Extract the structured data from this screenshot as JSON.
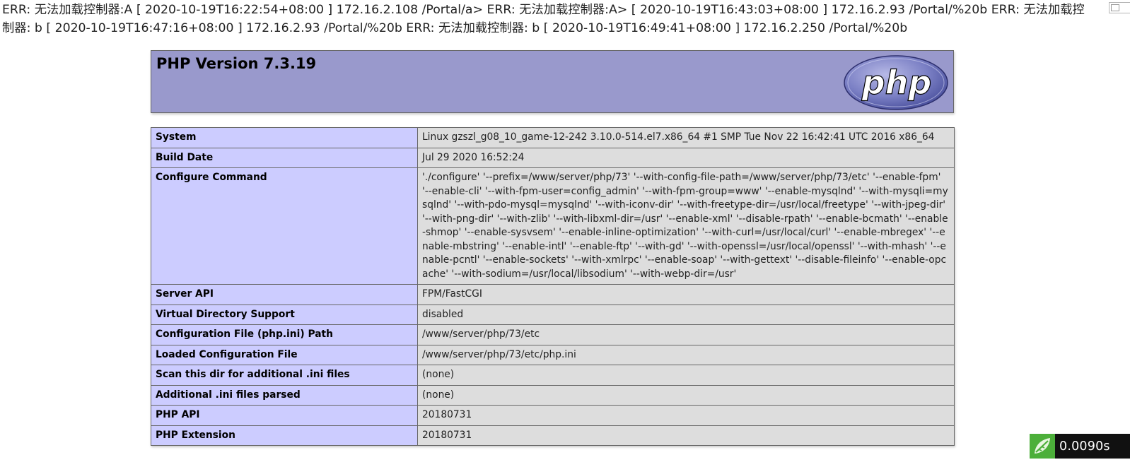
{
  "error_messages": "ERR: 无法加载控制器:A [ 2020-10-19T16:22:54+08:00 ] 172.16.2.108 /Portal/a> ERR: 无法加载控制器:A> [ 2020-10-19T16:43:03+08:00 ] 172.16.2.93 /Portal/%20b ERR: 无法加载控制器: b [ 2020-10-19T16:47:16+08:00 ] 172.16.2.93 /Portal/%20b ERR: 无法加载控制器: b [ 2020-10-19T16:49:41+08:00 ] 172.16.2.250 /Portal/%20b",
  "header": {
    "title": "PHP Version 7.3.19",
    "logo_text": "php"
  },
  "info_rows": [
    {
      "label": "System",
      "value": "Linux gzszl_g08_10_game-12-242 3.10.0-514.el7.x86_64 #1 SMP Tue Nov 22 16:42:41 UTC 2016 x86_64"
    },
    {
      "label": "Build Date",
      "value": "Jul 29 2020 16:52:24"
    },
    {
      "label": "Configure Command",
      "value": "'./configure' '--prefix=/www/server/php/73' '--with-config-file-path=/www/server/php/73/etc' '--enable-fpm' '--enable-cli' '--with-fpm-user=config_admin' '--with-fpm-group=www' '--enable-mysqlnd' '--with-mysqli=mysqlnd' '--with-pdo-mysql=mysqlnd' '--with-iconv-dir' '--with-freetype-dir=/usr/local/freetype' '--with-jpeg-dir' '--with-png-dir' '--with-zlib' '--with-libxml-dir=/usr' '--enable-xml' '--disable-rpath' '--enable-bcmath' '--enable-shmop' '--enable-sysvsem' '--enable-inline-optimization' '--with-curl=/usr/local/curl' '--enable-mbregex' '--enable-mbstring' '--enable-intl' '--enable-ftp' '--with-gd' '--with-openssl=/usr/local/openssl' '--with-mhash' '--enable-pcntl' '--enable-sockets' '--with-xmlrpc' '--enable-soap' '--with-gettext' '--disable-fileinfo' '--enable-opcache' '--with-sodium=/usr/local/libsodium' '--with-webp-dir=/usr'"
    },
    {
      "label": "Server API",
      "value": "FPM/FastCGI"
    },
    {
      "label": "Virtual Directory Support",
      "value": "disabled"
    },
    {
      "label": "Configuration File (php.ini) Path",
      "value": "/www/server/php/73/etc"
    },
    {
      "label": "Loaded Configuration File",
      "value": "/www/server/php/73/etc/php.ini"
    },
    {
      "label": "Scan this dir for additional .ini files",
      "value": "(none)"
    },
    {
      "label": "Additional .ini files parsed",
      "value": "(none)"
    },
    {
      "label": "PHP API",
      "value": "20180731"
    },
    {
      "label": "PHP Extension",
      "value": "20180731"
    }
  ],
  "timer": {
    "value": "0.0090s"
  },
  "colors": {
    "header_bg": "#9999cc",
    "label_bg": "#ccccff",
    "value_bg": "#dddddd",
    "timer_logo": "#4caf3a"
  },
  "icons": {
    "broken_image": "broken-image-icon",
    "php_logo": "php-logo",
    "timer_logo": "thinkphp-leaf-icon"
  }
}
